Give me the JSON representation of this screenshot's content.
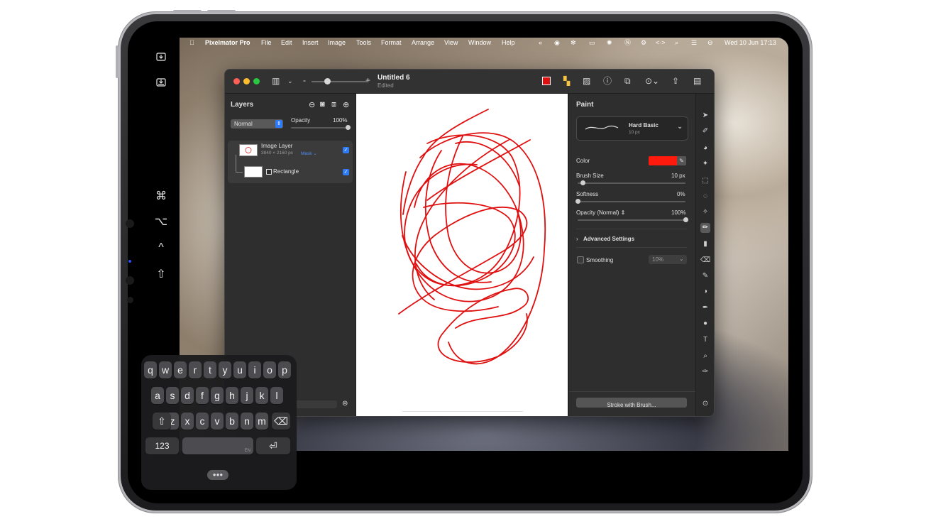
{
  "menubar": {
    "apple_icon": "apple-icon",
    "app_name": "Pixelmator Pro",
    "items": [
      "File",
      "Edit",
      "Insert",
      "Image",
      "Tools",
      "Format",
      "Arrange",
      "View",
      "Window",
      "Help"
    ],
    "clock": "Wed 10 Jun  17:13"
  },
  "window": {
    "title": "Untitled 6",
    "subtitle": "Edited",
    "zoom_minus": "-",
    "zoom_plus": "+"
  },
  "layers": {
    "title": "Layers",
    "blend_mode": "Normal",
    "opacity_label": "Opacity",
    "opacity_value": "100%",
    "opacity_fraction": 1.0,
    "items": [
      {
        "name": "Image Layer",
        "detail": "3840 × 2160 px",
        "mask": "Mask ⌄",
        "checked": true
      },
      {
        "name": "Rectangle",
        "checked": true
      }
    ]
  },
  "paint": {
    "title": "Paint",
    "brush_name": "Hard Basic",
    "brush_size_small": "10 px",
    "color_label": "Color",
    "color_value": "#ff1a0e",
    "brush_size_label": "Brush Size",
    "brush_size_value": "10 px",
    "brush_size_fraction": 0.05,
    "softness_label": "Softness",
    "softness_value": "0%",
    "softness_fraction": 0.0,
    "opacity_label": "Opacity (Normal) ⇕",
    "opacity_value": "100%",
    "opacity_fraction": 1.0,
    "advanced_label": "Advanced Settings",
    "smoothing_label": "Smoothing",
    "smoothing_value": "10%",
    "stroke_button": "Stroke with Brush..."
  },
  "keyboard": {
    "row1": [
      "q",
      "w",
      "e",
      "r",
      "t",
      "y",
      "u",
      "i",
      "o",
      "p"
    ],
    "row2": [
      "a",
      "s",
      "d",
      "f",
      "g",
      "h",
      "j",
      "k",
      "l"
    ],
    "row3": [
      "z",
      "x",
      "c",
      "v",
      "b",
      "n",
      "m"
    ],
    "numbers_key": "123",
    "space_lang": "EN",
    "return_symbol": "⏎",
    "shift_symbol": "⇧",
    "delete_symbol": "⌫"
  },
  "sidebar": {
    "modifiers": [
      "⌘",
      "⌥",
      "^",
      "⇧"
    ]
  },
  "colors": {
    "accent": "#2f7bf5",
    "scribble": "#e01010",
    "window_bg": "#2b2b2b"
  }
}
